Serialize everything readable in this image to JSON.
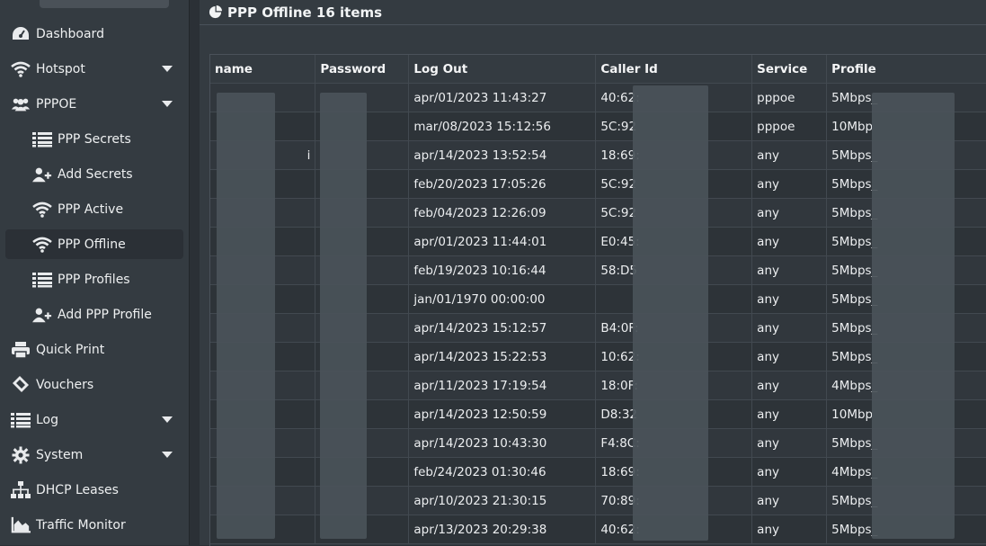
{
  "sidebar": {
    "items": [
      {
        "label": "Dashboard",
        "icon": "dashboard-icon"
      },
      {
        "label": "Hotspot",
        "icon": "wifi-icon",
        "caret": true
      },
      {
        "label": "PPPOE",
        "icon": "users-icon",
        "caret": true
      },
      {
        "label": "PPP Secrets",
        "icon": "list-icon",
        "sub": true
      },
      {
        "label": "Add Secrets",
        "icon": "user-plus-icon",
        "sub": true
      },
      {
        "label": "PPP Active",
        "icon": "wifi-icon",
        "sub": true
      },
      {
        "label": "PPP Offline",
        "icon": "wifi-icon",
        "sub": true,
        "active": true
      },
      {
        "label": "PPP Profiles",
        "icon": "list-icon",
        "sub": true
      },
      {
        "label": "Add PPP Profile",
        "icon": "user-plus-icon",
        "sub": true
      },
      {
        "label": "Quick Print",
        "icon": "printer-icon"
      },
      {
        "label": "Vouchers",
        "icon": "ticket-icon"
      },
      {
        "label": "Log",
        "icon": "list-icon",
        "caret": true
      },
      {
        "label": "System",
        "icon": "gear-icon",
        "caret": true
      },
      {
        "label": "DHCP Leases",
        "icon": "sitemap-icon"
      },
      {
        "label": "Traffic Monitor",
        "icon": "area-chart-icon"
      }
    ]
  },
  "header": {
    "title": "PPP Offline 16 items",
    "icon": "pie-chart-icon"
  },
  "table": {
    "columns": [
      "name",
      "Password",
      "Log Out",
      "Caller Id",
      "Service",
      "Profile"
    ],
    "rows": [
      {
        "name": "",
        "log_out": "apr/01/2023 11:43:27",
        "caller_id": "40:62:",
        "service": "pppoe",
        "profile": "5Mbps_"
      },
      {
        "name": "",
        "log_out": "mar/08/2023 15:12:56",
        "caller_id": "5C:92",
        "service": "pppoe",
        "profile": "10Mbp"
      },
      {
        "name": "i",
        "log_out": "apr/14/2023 13:52:54",
        "caller_id": "18:69:",
        "service": "any",
        "profile": "5Mbps_"
      },
      {
        "name": "",
        "log_out": "feb/20/2023 17:05:26",
        "caller_id": "5C:92",
        "service": "any",
        "profile": "5Mbps_"
      },
      {
        "name": "",
        "log_out": "feb/04/2023 12:26:09",
        "caller_id": "5C:92",
        "service": "any",
        "profile": "5Mbps_"
      },
      {
        "name": "",
        "log_out": "apr/01/2023 11:44:01",
        "caller_id": "E0:45:",
        "service": "any",
        "profile": "5Mbps_"
      },
      {
        "name": "",
        "log_out": "feb/19/2023 10:16:44",
        "caller_id": "58:D5",
        "service": "any",
        "profile": "5Mbps_"
      },
      {
        "name": "",
        "log_out": "jan/01/1970 00:00:00",
        "caller_id": "",
        "service": "any",
        "profile": "5Mbps_"
      },
      {
        "name": "",
        "log_out": "apr/14/2023 15:12:57",
        "caller_id": "B4:0F:",
        "service": "any",
        "profile": "5Mbps_"
      },
      {
        "name": "",
        "log_out": "apr/14/2023 15:22:53",
        "caller_id": "10:62:",
        "service": "any",
        "profile": "5Mbps_"
      },
      {
        "name": "",
        "log_out": "apr/11/2023 17:19:54",
        "caller_id": "18:0F:",
        "service": "any",
        "profile": "4Mbps_"
      },
      {
        "name": "",
        "log_out": "apr/14/2023 12:50:59",
        "caller_id": "D8:32",
        "service": "any",
        "profile": "10Mbp"
      },
      {
        "name": "",
        "log_out": "apr/14/2023 10:43:30",
        "caller_id": "F4:8C:",
        "service": "any",
        "profile": "5Mbps_"
      },
      {
        "name": "",
        "log_out": "feb/24/2023 01:30:46",
        "caller_id": "18:69:",
        "service": "any",
        "profile": "4Mbps_"
      },
      {
        "name": "",
        "log_out": "apr/10/2023 21:30:15",
        "caller_id": "70:89:",
        "service": "any",
        "profile": "5Mbps_"
      },
      {
        "name": "",
        "log_out": "apr/13/2023 20:29:38",
        "caller_id": "40:62:",
        "service": "any",
        "profile": "5Mbps_"
      }
    ]
  },
  "colors": {
    "sidebar_bg": "#343b41",
    "page_bg": "#2b3036",
    "text": "#e6e8ea"
  }
}
